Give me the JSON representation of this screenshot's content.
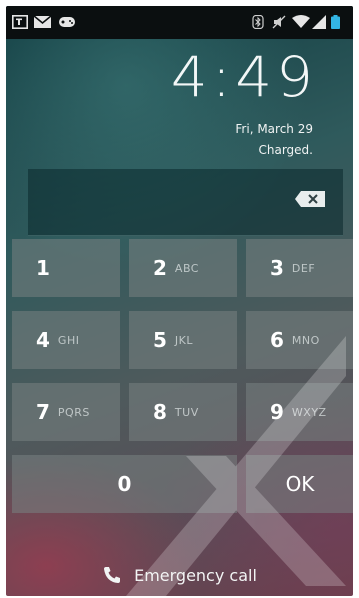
{
  "status_bar": {
    "left_icons": [
      "screen-icon",
      "mail-icon",
      "game-controller-icon"
    ],
    "right_icons": [
      "bluetooth-icon",
      "no-sound-icon",
      "wifi-icon",
      "signal-icon",
      "battery-icon"
    ]
  },
  "lockscreen": {
    "time": "4:49",
    "date": "Fri, March 29",
    "battery_status": "Charged."
  },
  "pin_entry": {
    "value": "",
    "delete_icon": "backspace-icon"
  },
  "keypad": {
    "keys": [
      {
        "num": "1",
        "letters": ""
      },
      {
        "num": "2",
        "letters": "ABC"
      },
      {
        "num": "3",
        "letters": "DEF"
      },
      {
        "num": "4",
        "letters": "GHI"
      },
      {
        "num": "5",
        "letters": "JKL"
      },
      {
        "num": "6",
        "letters": "MNO"
      },
      {
        "num": "7",
        "letters": "PQRS"
      },
      {
        "num": "8",
        "letters": "TUV"
      },
      {
        "num": "9",
        "letters": "WXYZ"
      },
      {
        "num": "0",
        "letters": ""
      }
    ],
    "ok_label": "OK"
  },
  "emergency": {
    "label": "Emergency call",
    "icon": "phone-icon"
  },
  "colors": {
    "status_bar_bg": "#0b0f10",
    "accent": "#33b5e5"
  }
}
